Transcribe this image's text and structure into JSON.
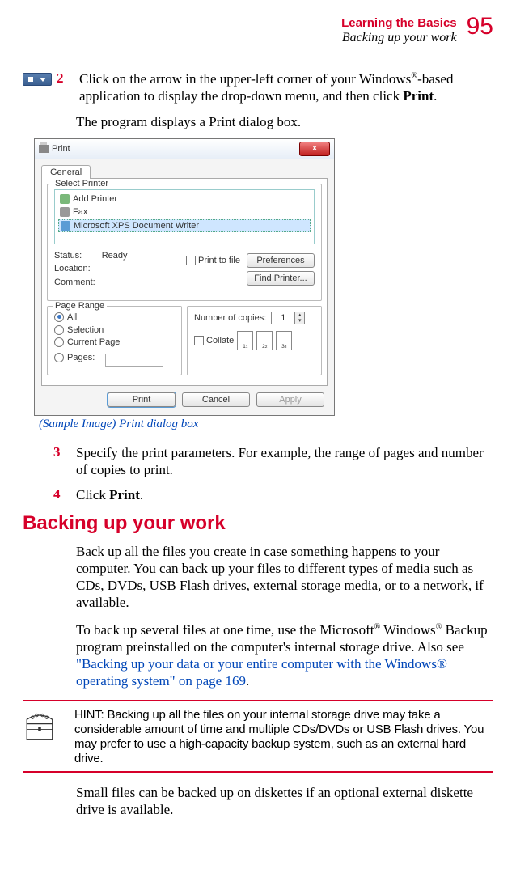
{
  "header": {
    "chapter": "Learning the Basics",
    "section": "Backing up your work",
    "page_number": "95"
  },
  "steps": {
    "s2": {
      "num": "2",
      "text_a": "Click on the arrow in the upper-left corner of your Windows",
      "reg1": "®",
      "text_b": "-based application to display the drop-down menu, and then click ",
      "bold": "Print",
      "text_c": "."
    },
    "after2": "The program displays a Print dialog box.",
    "caption": "(Sample Image) Print dialog box",
    "s3": {
      "num": "3",
      "text": "Specify the print parameters. For example, the range of pages and number of copies to print."
    },
    "s4": {
      "num": "4",
      "text_a": "Click ",
      "bold": "Print",
      "text_b": "."
    }
  },
  "dialog": {
    "title": "Print",
    "tab": "General",
    "group_select": "Select Printer",
    "printers": {
      "add": "Add Printer",
      "fax": "Fax",
      "xps": "Microsoft XPS Document Writer"
    },
    "status_label": "Status:",
    "status_value": "Ready",
    "location_label": "Location:",
    "comment_label": "Comment:",
    "print_to_file": "Print to file",
    "preferences": "Preferences",
    "find_printer": "Find Printer...",
    "group_range": "Page Range",
    "range_all": "All",
    "range_selection": "Selection",
    "range_current": "Current Page",
    "range_pages": "Pages:",
    "copies_label": "Number of copies:",
    "copies_value": "1",
    "collate": "Collate",
    "collate_pages": {
      "p1a": "1",
      "p1b": "1",
      "p2a": "2",
      "p2b": "2",
      "p3a": "3",
      "p3b": "3"
    },
    "btn_print": "Print",
    "btn_cancel": "Cancel",
    "btn_apply": "Apply"
  },
  "section_heading": "Backing up your work",
  "para1": "Back up all the files you create in case something happens to your computer. You can back up your files to different types of media such as CDs, DVDs, USB Flash drives, external storage media, or to a network, if available.",
  "para2_a": "To back up several files at one time, use the Microsoft",
  "para2_reg1": "®",
  "para2_b": " Windows",
  "para2_reg2": "®",
  "para2_c": " Backup program preinstalled on the computer's internal storage drive. Also see ",
  "para2_link": "\"Backing up your data or your entire computer with the Windows® operating system\" on page 169",
  "para2_d": ".",
  "hint": "HINT: Backing up all the files on your internal storage drive may take a considerable amount of time and multiple CDs/DVDs or USB Flash drives. You may prefer to use a high-capacity backup system, such as an external hard drive.",
  "para3": "Small files can be backed up on diskettes if an optional external diskette drive is available."
}
